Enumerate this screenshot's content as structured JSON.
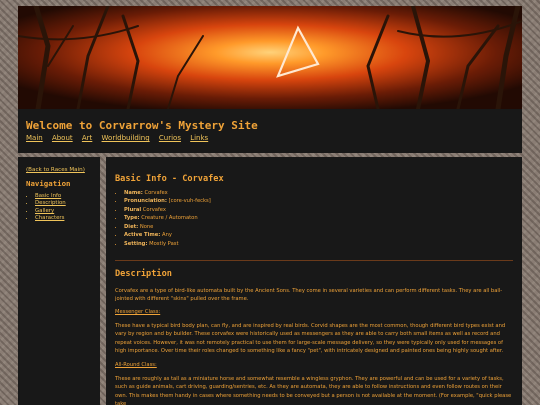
{
  "banner": {
    "alt": "glowing triangle in a dark forest"
  },
  "header": {
    "title": "Welcome to Corvarrow's Mystery Site",
    "nav": [
      "Main",
      "About",
      "Art",
      "Worldbuilding",
      "Curios",
      "Links"
    ]
  },
  "sidebar": {
    "back_link": "(Back to Races Main)",
    "heading": "Navigation",
    "items": [
      "Basic Info",
      "Description",
      "Gallery",
      "Characters"
    ]
  },
  "basic_info": {
    "title": "Basic Info - Corvafex",
    "items": [
      {
        "label": "Name:",
        "value": "Corvafex"
      },
      {
        "label": "Pronunciation:",
        "value": "[core-vuh-fecks]"
      },
      {
        "label": "Plural",
        "value": "Corvafex"
      },
      {
        "label": "Type:",
        "value": "Creature / Automaton"
      },
      {
        "label": "Diet:",
        "value": "None"
      },
      {
        "label": "Active Time:",
        "value": "Any"
      },
      {
        "label": "Setting:",
        "value": "Mostly Past"
      }
    ]
  },
  "description": {
    "title": "Description",
    "intro": "Corvafex are a type of bird-like automata built by the Ancient Sons. They come in several varieties and can perform different tasks. They are all ball-jointed with different \"skins\" pulled over the frame.",
    "messenger_title": "Messenger Class:",
    "messenger_text": "These have a typical bird body plan, can fly, and are inspired by real birds. Corvid shapes are the most common, though different bird types exist and vary by region and by builder. These corvafex were historically used as messengers as they are able to carry both small items as well as record and repeat voices. However, it was not remotely practical to use them for large-scale message delivery, so they were typically only used for messages of high importance. Over time their roles changed to something like a fancy \"pet\", with intricately designed and painted ones being highly sought after.",
    "allround_title": "All-Round Class:",
    "allround_text": "These are roughly as tall as a miniature horse and somewhat resemble a wingless gryphon. They are powerful and can be used for a variety of tasks, such as guide animals, cart driving, guarding/sentries, etc. As they are automata, they are able to follow instructions and even follow routes on their own. This makes them handy in cases where something needs to be conveyed but a person is not available at the moment. (For example, \"quick please take"
  },
  "colors": {
    "accent": "#f0a338",
    "link": "#f0c45a",
    "panel": "#181818"
  }
}
